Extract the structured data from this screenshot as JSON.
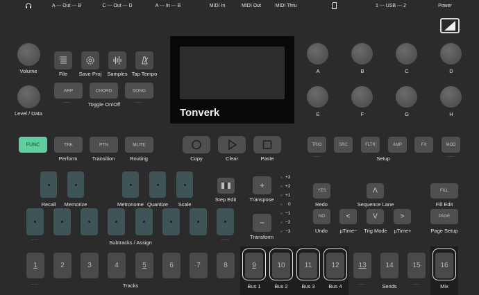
{
  "top_bar": {
    "ports": [
      {
        "id": "headphones",
        "label": ""
      },
      {
        "id": "a-out-b",
        "label": "A --- Out --- B"
      },
      {
        "id": "c-out-d",
        "label": "C --- Out --- D"
      },
      {
        "id": "a-in-b",
        "label": "A --- In --- B"
      },
      {
        "id": "midi-in",
        "label": "MIDI In"
      },
      {
        "id": "midi-out",
        "label": "MIDI Out"
      },
      {
        "id": "midi-thru",
        "label": "MIDI Thru"
      },
      {
        "id": "sd-card",
        "label": ""
      },
      {
        "id": "usb",
        "label": "1 --- USB --- 2"
      },
      {
        "id": "power",
        "label": "Power"
      }
    ]
  },
  "left_knobs": {
    "volume": "Volume",
    "level_data": "Level / Data"
  },
  "menu_buttons": [
    {
      "label": "File",
      "icon": "list-icon"
    },
    {
      "label": "Save Proj",
      "icon": "gear-icon"
    },
    {
      "label": "Samples",
      "icon": "waveform-icon"
    },
    {
      "label": "Tap Tempo",
      "icon": "metronome-icon"
    }
  ],
  "toggle_row": {
    "buttons": [
      "ARP",
      "CHORD",
      "SONG"
    ],
    "caption": "Toggle On/Off",
    "left_dots": "......",
    "right_dots": "......"
  },
  "screen": {
    "brand": "Tonverk"
  },
  "right_knobs": {
    "row1": [
      "A",
      "B",
      "C",
      "D"
    ],
    "row2": [
      "E",
      "F",
      "G",
      "H"
    ]
  },
  "func_row": {
    "func": "FUNC",
    "buttons": [
      {
        "key": "TRK",
        "caption": "Perform"
      },
      {
        "key": "PTN",
        "caption": "Transition"
      },
      {
        "key": "MUTE",
        "caption": "Routing"
      }
    ]
  },
  "transport": {
    "copy": "Copy",
    "clear": "Clear",
    "paste": "Paste"
  },
  "setup_row": {
    "buttons": [
      "TRIG",
      "SRC",
      "FLTR",
      "AMP",
      "FX",
      "MOD"
    ],
    "caption": "Setup",
    "left_dots": "......",
    "right_dots": "......"
  },
  "teal_top": {
    "recall": "Recall",
    "memorize": "Memorize",
    "metronome": "Metronome",
    "quantize": "Quantize",
    "scale": "Scale"
  },
  "step_edit": "Step Edit",
  "transpose": {
    "label": "Transpose",
    "plus": "+",
    "minus": "−",
    "caption2": "Transform"
  },
  "scale_leds": [
    "+3",
    "+2",
    "+1",
    "0",
    "−1",
    "−2",
    "−3"
  ],
  "teal_row": {
    "caption": "Subtracks / Assign",
    "left_dots": "......",
    "right_dots": "......"
  },
  "right_cluster": {
    "yes": "YES",
    "redo": "Redo",
    "no": "NO",
    "undo": "Undo",
    "up": "Λ",
    "seq_lane": "Sequence Lane",
    "left": "<",
    "down": "V",
    "right": ">",
    "utime_minus": "µTime−",
    "trig_mode": "Trig Mode",
    "utime_plus": "µTime+",
    "fill": "FILL",
    "fill_edit": "Fill Edit",
    "page": "PAGE",
    "page_setup": "Page Setup"
  },
  "pads": [
    {
      "n": "1",
      "u": true
    },
    {
      "n": "2",
      "u": false
    },
    {
      "n": "3",
      "u": false
    },
    {
      "n": "4",
      "u": false
    },
    {
      "n": "5",
      "u": true
    },
    {
      "n": "6",
      "u": false
    },
    {
      "n": "7",
      "u": false
    },
    {
      "n": "8",
      "u": false
    },
    {
      "n": "9",
      "u": true
    },
    {
      "n": "10",
      "u": false
    },
    {
      "n": "11",
      "u": false
    },
    {
      "n": "12",
      "u": false
    },
    {
      "n": "13",
      "u": true
    },
    {
      "n": "14",
      "u": false
    },
    {
      "n": "15",
      "u": false
    },
    {
      "n": "16",
      "u": false
    }
  ],
  "pad_captions": {
    "left_dots": "......",
    "tracks": "Tracks",
    "bus1": "Bus 1",
    "bus2": "Bus 2",
    "bus3": "Bus 3",
    "bus4": "Bus 4",
    "sends_left": "......",
    "sends": "Sends",
    "sends_right": "......",
    "mix": "Mix"
  },
  "colors": {
    "func": "#5fcf9f",
    "teal": "#3e5457",
    "body": "#2b2b2c",
    "button": "#4f4f51"
  }
}
